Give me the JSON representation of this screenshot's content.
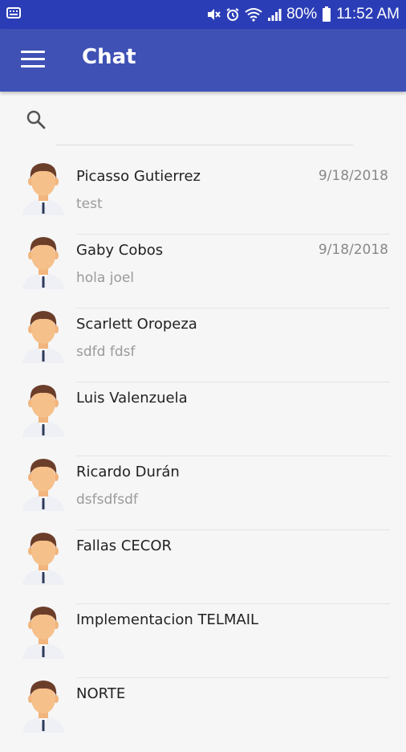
{
  "status_bar": {
    "battery": "80%",
    "time": "11:52 AM"
  },
  "toolbar": {
    "title": "Chat"
  },
  "search": {
    "placeholder": ""
  },
  "chats": [
    {
      "name": "Picasso Gutierrez",
      "message": "test",
      "date": "9/18/2018"
    },
    {
      "name": "Gaby Cobos",
      "message": "hola joel",
      "date": "9/18/2018"
    },
    {
      "name": "Scarlett Oropeza",
      "message": "sdfd fdsf",
      "date": ""
    },
    {
      "name": "Luis Valenzuela",
      "message": "",
      "date": ""
    },
    {
      "name": "Ricardo Durán",
      "message": "dsfsdfsdf",
      "date": ""
    },
    {
      "name": "Fallas CECOR",
      "message": "",
      "date": ""
    },
    {
      "name": "Implementacion TELMAIL",
      "message": "",
      "date": ""
    },
    {
      "name": "NORTE",
      "message": "",
      "date": ""
    }
  ],
  "colors": {
    "appbar": "#3f51b5",
    "statusbar": "#2b3db6",
    "avatar_skin": "#f6c08a",
    "avatar_hair": "#6b3e2a"
  }
}
